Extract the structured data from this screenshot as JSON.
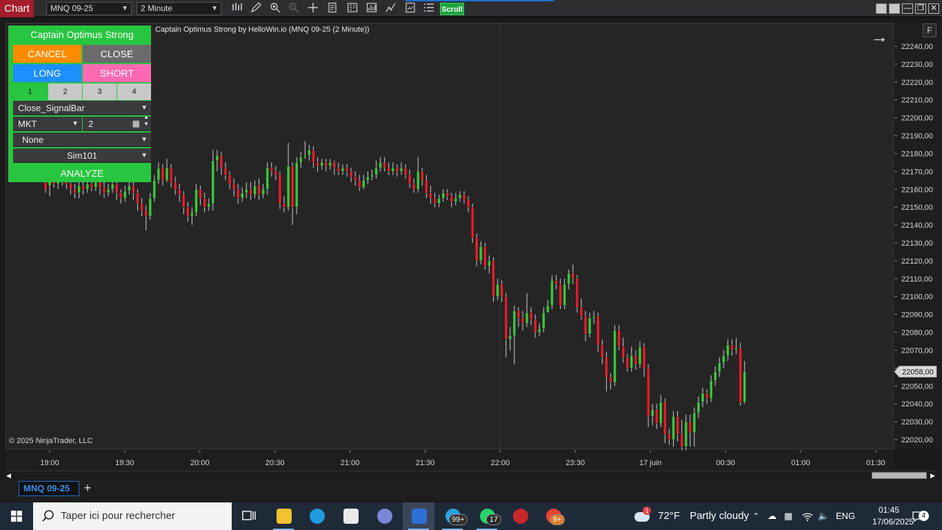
{
  "toolbar": {
    "chart_menu": "Chart",
    "instrument": "MNQ 09-25",
    "interval": "2 Minute",
    "scroll_label": "Scroll",
    "icons": [
      "bar-type-icon",
      "drawing-pencil-icon",
      "zoom-in-icon",
      "zoom-out-icon",
      "crosshair-icon",
      "data-box-icon",
      "properties-icon",
      "indicators-icon",
      "strategies-icon",
      "templates-icon",
      "order-list-icon"
    ]
  },
  "chart": {
    "title": "Captain Optimus Strong by HelloWin.io (MNQ 09-25 (2 Minute))",
    "copyright": "© 2025 NinjaTrader, LLC",
    "f_label": "F",
    "current_price": "22058,00",
    "price_labels": [
      "22240,00",
      "22230,00",
      "22220,00",
      "22210,00",
      "22200,00",
      "22190,00",
      "22180,00",
      "22170,00",
      "22160,00",
      "22150,00",
      "22140,00",
      "22130,00",
      "22120,00",
      "22110,00",
      "22100,00",
      "22090,00",
      "22080,00",
      "22070,00",
      "22060,00",
      "22050,00",
      "22040,00",
      "22030,00",
      "22020,00"
    ],
    "time_labels": [
      "19:00",
      "19:30",
      "20:00",
      "20:30",
      "21:00",
      "21:30",
      "22:00",
      "23:30",
      "17 juin",
      "00:30",
      "01:00",
      "01:30"
    ],
    "colors": {
      "up": "#3cc43c",
      "down": "#e0202a",
      "wick": "#cfcfcf",
      "background": "#252526"
    }
  },
  "chart_data": {
    "type": "candlestick",
    "y_axis_range": [
      22014,
      22252
    ],
    "candles": [
      [
        22164,
        22160,
        22167,
        22158
      ],
      [
        22162,
        22165,
        22168,
        22156
      ],
      [
        22165,
        22163,
        22170,
        22161
      ],
      [
        22163,
        22164,
        22169,
        22160
      ],
      [
        22164,
        22166,
        22170,
        22162
      ],
      [
        22166,
        22163,
        22168,
        22160
      ],
      [
        22163,
        22160,
        22166,
        22157
      ],
      [
        22160,
        22158,
        22163,
        22155
      ],
      [
        22158,
        22162,
        22165,
        22155
      ],
      [
        22162,
        22160,
        22165,
        22157
      ],
      [
        22160,
        22163,
        22166,
        22158
      ],
      [
        22163,
        22161,
        22167,
        22159
      ],
      [
        22161,
        22164,
        22168,
        22159
      ],
      [
        22164,
        22161,
        22166,
        22157
      ],
      [
        22161,
        22158,
        22164,
        22155
      ],
      [
        22158,
        22160,
        22163,
        22156
      ],
      [
        22160,
        22163,
        22166,
        22158
      ],
      [
        22163,
        22158,
        22165,
        22154
      ],
      [
        22158,
        22155,
        22160,
        22152
      ],
      [
        22155,
        22159,
        22162,
        22153
      ],
      [
        22159,
        22162,
        22165,
        22157
      ],
      [
        22162,
        22158,
        22164,
        22154
      ],
      [
        22158,
        22152,
        22160,
        22148
      ],
      [
        22152,
        22148,
        22155,
        22145
      ],
      [
        22148,
        22145,
        22151,
        22137
      ],
      [
        22145,
        22155,
        22158,
        22143
      ],
      [
        22155,
        22165,
        22168,
        22153
      ],
      [
        22165,
        22172,
        22175,
        22163
      ],
      [
        22172,
        22165,
        22174,
        22162
      ],
      [
        22165,
        22172,
        22177,
        22164
      ],
      [
        22172,
        22164,
        22174,
        22161
      ],
      [
        22164,
        22160,
        22167,
        22157
      ],
      [
        22160,
        22157,
        22163,
        22153
      ],
      [
        22157,
        22150,
        22159,
        22146
      ],
      [
        22150,
        22145,
        22153,
        22142
      ],
      [
        22145,
        22147,
        22150,
        22140
      ],
      [
        22147,
        22160,
        22163,
        22145
      ],
      [
        22160,
        22155,
        22162,
        22151
      ],
      [
        22155,
        22150,
        22158,
        22147
      ],
      [
        22150,
        22152,
        22155,
        22148
      ],
      [
        22152,
        22176,
        22182,
        22148
      ],
      [
        22176,
        22179,
        22182,
        22170
      ],
      [
        22179,
        22172,
        22181,
        22168
      ],
      [
        22172,
        22168,
        22175,
        22165
      ],
      [
        22168,
        22163,
        22170,
        22160
      ],
      [
        22163,
        22160,
        22166,
        22156
      ],
      [
        22160,
        22155,
        22163,
        22152
      ],
      [
        22155,
        22158,
        22161,
        22153
      ],
      [
        22158,
        22160,
        22164,
        22155
      ],
      [
        22160,
        22157,
        22164,
        22154
      ],
      [
        22157,
        22162,
        22165,
        22155
      ],
      [
        22162,
        22157,
        22166,
        22154
      ],
      [
        22157,
        22160,
        22163,
        22155
      ],
      [
        22160,
        22172,
        22175,
        22157
      ],
      [
        22172,
        22170,
        22175,
        22167
      ],
      [
        22170,
        22168,
        22173,
        22165
      ],
      [
        22168,
        22152,
        22170,
        22149
      ],
      [
        22152,
        22150,
        22156,
        22147
      ],
      [
        22150,
        22173,
        22186,
        22148
      ],
      [
        22173,
        22150,
        22175,
        22140
      ],
      [
        22150,
        22175,
        22178,
        22146
      ],
      [
        22175,
        22178,
        22181,
        22172
      ],
      [
        22178,
        22179,
        22187,
        22177
      ],
      [
        22179,
        22182,
        22185,
        22176
      ],
      [
        22182,
        22175,
        22184,
        22172
      ],
      [
        22175,
        22173,
        22178,
        22170
      ],
      [
        22173,
        22175,
        22177,
        22171
      ],
      [
        22175,
        22173,
        22177,
        22170
      ],
      [
        22173,
        22175,
        22177,
        22171
      ],
      [
        22175,
        22172,
        22176,
        22168
      ],
      [
        22172,
        22170,
        22175,
        22168
      ],
      [
        22170,
        22172,
        22174,
        22168
      ],
      [
        22172,
        22170,
        22174,
        22167
      ],
      [
        22170,
        22167,
        22172,
        22164
      ],
      [
        22167,
        22165,
        22170,
        22162
      ],
      [
        22165,
        22161,
        22168,
        22159
      ],
      [
        22161,
        22165,
        22168,
        22160
      ],
      [
        22165,
        22167,
        22170,
        22163
      ],
      [
        22167,
        22168,
        22171,
        22165
      ],
      [
        22168,
        22172,
        22176,
        22166
      ],
      [
        22172,
        22175,
        22178,
        22170
      ],
      [
        22175,
        22172,
        22178,
        22170
      ],
      [
        22172,
        22170,
        22175,
        22168
      ],
      [
        22170,
        22172,
        22175,
        22168
      ],
      [
        22172,
        22170,
        22174,
        22167
      ],
      [
        22170,
        22172,
        22175,
        22168
      ],
      [
        22172,
        22168,
        22174,
        22166
      ],
      [
        22168,
        22163,
        22171,
        22161
      ],
      [
        22163,
        22160,
        22166,
        22158
      ],
      [
        22160,
        22170,
        22178,
        22158
      ],
      [
        22170,
        22165,
        22172,
        22162
      ],
      [
        22165,
        22158,
        22168,
        22155
      ],
      [
        22158,
        22155,
        22162,
        22152
      ],
      [
        22155,
        22152,
        22158,
        22150
      ],
      [
        22152,
        22155,
        22157,
        22150
      ],
      [
        22155,
        22158,
        22160,
        22153
      ],
      [
        22158,
        22156,
        22160,
        22154
      ],
      [
        22156,
        22153,
        22158,
        22150
      ],
      [
        22153,
        22155,
        22158,
        22151
      ],
      [
        22155,
        22157,
        22159,
        22153
      ],
      [
        22157,
        22154,
        22159,
        22152
      ],
      [
        22154,
        22150,
        22156,
        22147
      ],
      [
        22150,
        22133,
        22152,
        22130
      ],
      [
        22133,
        22120,
        22135,
        22117
      ],
      [
        22120,
        22128,
        22131,
        22118
      ],
      [
        22128,
        22117,
        22130,
        22115
      ],
      [
        22117,
        22120,
        22123,
        22113
      ],
      [
        22120,
        22100,
        22122,
        22097
      ],
      [
        22100,
        22107,
        22110,
        22098
      ],
      [
        22107,
        22100,
        22109,
        22097
      ],
      [
        22100,
        22076,
        22102,
        22066
      ],
      [
        22076,
        22078,
        22083,
        22070
      ],
      [
        22078,
        22092,
        22095,
        22062
      ],
      [
        22092,
        22088,
        22094,
        22083
      ],
      [
        22088,
        22085,
        22092,
        22081
      ],
      [
        22085,
        22091,
        22102,
        22083
      ],
      [
        22091,
        22087,
        22094,
        22084
      ],
      [
        22087,
        22080,
        22090,
        22077
      ],
      [
        22080,
        22082,
        22085,
        22078
      ],
      [
        22082,
        22091,
        22094,
        22080
      ],
      [
        22091,
        22095,
        22098,
        22092
      ],
      [
        22095,
        22109,
        22112,
        22093
      ],
      [
        22109,
        22107,
        22112,
        22104
      ],
      [
        22107,
        22095,
        22110,
        22093
      ],
      [
        22095,
        22107,
        22110,
        22093
      ],
      [
        22107,
        22113,
        22115,
        22104
      ],
      [
        22113,
        22110,
        22118,
        22107
      ],
      [
        22110,
        22094,
        22112,
        22091
      ],
      [
        22094,
        22089,
        22099,
        22087
      ],
      [
        22089,
        22079,
        22092,
        22075
      ],
      [
        22079,
        22088,
        22091,
        22077
      ],
      [
        22088,
        22089,
        22092,
        22085
      ],
      [
        22089,
        22073,
        22091,
        22069
      ],
      [
        22073,
        22066,
        22076,
        22062
      ],
      [
        22066,
        22055,
        22069,
        22047
      ],
      [
        22055,
        22052,
        22057,
        22048
      ],
      [
        22052,
        22081,
        22084,
        22050
      ],
      [
        22081,
        22072,
        22084,
        22070
      ],
      [
        22072,
        22066,
        22077,
        22063
      ],
      [
        22066,
        22060,
        22068,
        22058
      ],
      [
        22060,
        22067,
        22072,
        22058
      ],
      [
        22067,
        22062,
        22070,
        22059
      ],
      [
        22062,
        22072,
        22075,
        22060
      ],
      [
        22072,
        22060,
        22074,
        22055
      ],
      [
        22060,
        22033,
        22062,
        22027
      ],
      [
        22033,
        22037,
        22040,
        22028
      ],
      [
        22037,
        22029,
        22040,
        22026
      ],
      [
        22029,
        22041,
        22045,
        22027
      ],
      [
        22041,
        22023,
        22043,
        22018
      ],
      [
        22023,
        22020,
        22026,
        22017
      ],
      [
        22020,
        22033,
        22036,
        22016
      ],
      [
        22033,
        22023,
        22036,
        22019
      ],
      [
        22023,
        22016,
        22031,
        22014
      ],
      [
        22016,
        22030,
        22034,
        22014
      ],
      [
        22030,
        22024,
        22034,
        22016
      ],
      [
        22024,
        22035,
        22038,
        22016
      ],
      [
        22035,
        22041,
        22044,
        22032
      ],
      [
        22041,
        22046,
        22049,
        22038
      ],
      [
        22046,
        22043,
        22048,
        22040
      ],
      [
        22043,
        22053,
        22056,
        22041
      ],
      [
        22053,
        22058,
        22061,
        22050
      ],
      [
        22058,
        22063,
        22066,
        22055
      ],
      [
        22063,
        22067,
        22070,
        22060
      ],
      [
        22067,
        22073,
        22076,
        22064
      ],
      [
        22073,
        22070,
        22076,
        22067
      ],
      [
        22070,
        22071,
        22077,
        22068
      ],
      [
        22071,
        22041,
        22074,
        22039
      ],
      [
        22041,
        22058,
        22064,
        22040
      ]
    ]
  },
  "panel": {
    "title": "Captain Optimus Strong",
    "cancel": "CANCEL",
    "close": "CLOSE",
    "long": "LONG",
    "short": "SHORT",
    "tabs": [
      "1",
      "2",
      "3",
      "4"
    ],
    "close_mode": "Close_SignalBar",
    "order_type": "MKT",
    "quantity": "2",
    "atm": "None",
    "account": "Sim101",
    "analyze": "ANALYZE",
    "colors": {
      "cancel": "#ff8c00",
      "close": "#6b6b6b",
      "long": "#1e8fff",
      "short": "#ff69b4",
      "green": "#28c640"
    }
  },
  "tabs": {
    "active": "MNQ 09-25",
    "add": "+"
  },
  "taskbar": {
    "search_placeholder": "Taper ici pour rechercher",
    "weather_temp": "72°F",
    "weather_text": "Partly cloudy",
    "language": "ENG",
    "time": "01:45",
    "date": "17/06/2025",
    "badges": {
      "telegram": "99+",
      "whatsapp": "17",
      "chrome": "9+",
      "notifications": "4",
      "weather_alert": "1"
    }
  }
}
